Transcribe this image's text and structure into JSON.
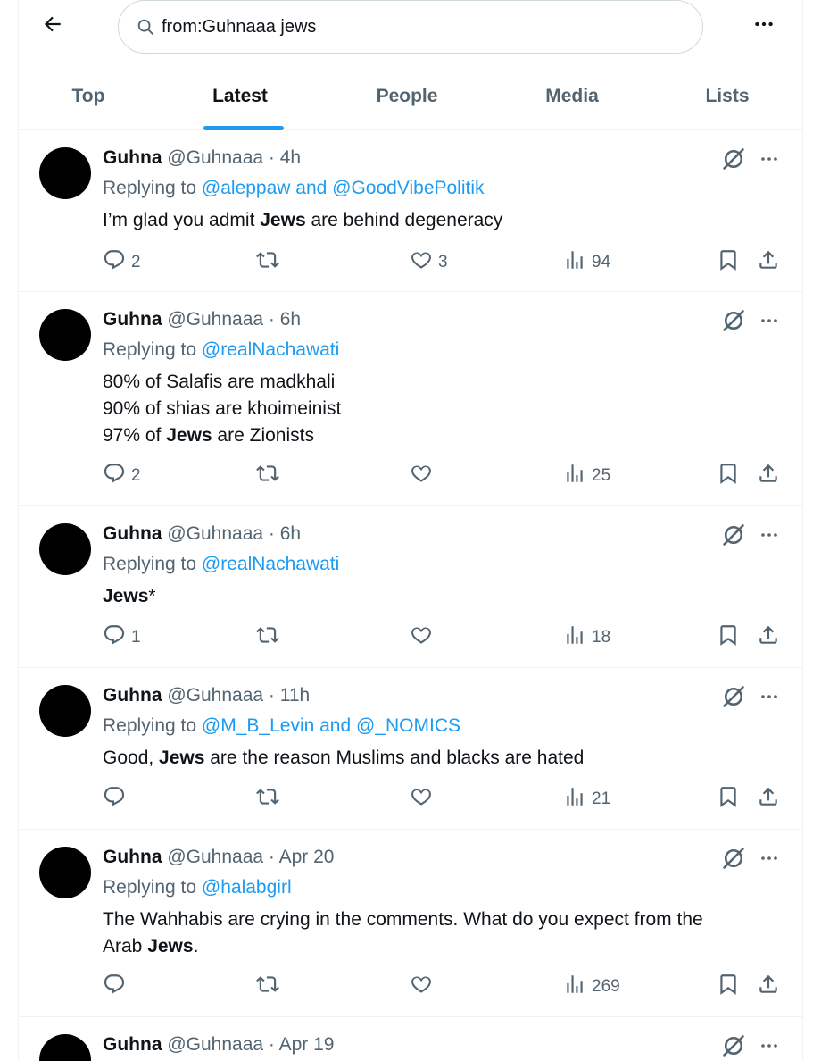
{
  "search": {
    "query": "from:Guhnaaa jews"
  },
  "tabs": [
    {
      "label": "Top"
    },
    {
      "label": "Latest"
    },
    {
      "label": "People"
    },
    {
      "label": "Media"
    },
    {
      "label": "Lists"
    }
  ],
  "active_tab": "Latest",
  "tweets": [
    {
      "name": "Guhna",
      "meta": "@Guhnaaa · 4h",
      "replying_prefix": "Replying to ",
      "replying_to": "@aleppaw and @GoodVibePolitik",
      "lines": [
        [
          "I’m glad you admit ",
          "Jews",
          " are behind degeneracy"
        ]
      ],
      "replies": "2",
      "retweets": "",
      "likes": "3",
      "views": "94"
    },
    {
      "name": "Guhna",
      "meta": "@Guhnaaa · 6h",
      "replying_prefix": "Replying to ",
      "replying_to": "@realNachawati",
      "lines": [
        [
          "80% of Salafis are madkhali",
          "",
          ""
        ],
        [
          "90% of shias are khoimeinist",
          "",
          ""
        ],
        [
          "97% of ",
          "Jews",
          " are Zionists"
        ]
      ],
      "replies": "2",
      "retweets": "",
      "likes": "",
      "views": "25"
    },
    {
      "name": "Guhna",
      "meta": "@Guhnaaa · 6h",
      "replying_prefix": "Replying to ",
      "replying_to": "@realNachawati",
      "lines": [
        [
          "",
          "Jews",
          "*"
        ]
      ],
      "replies": "1",
      "retweets": "",
      "likes": "",
      "views": "18"
    },
    {
      "name": "Guhna",
      "meta": "@Guhnaaa · 11h",
      "replying_prefix": "Replying to ",
      "replying_to": "@M_B_Levin and @_NOMICS",
      "lines": [
        [
          "Good, ",
          "Jews",
          " are the reason Muslims and blacks are hated"
        ]
      ],
      "replies": "",
      "retweets": "",
      "likes": "",
      "views": "21"
    },
    {
      "name": "Guhna",
      "meta": "@Guhnaaa · Apr 20",
      "replying_prefix": "Replying to ",
      "replying_to": "@halabgirl",
      "lines": [
        [
          "The Wahhabis are crying in the comments. What do you expect from the",
          "",
          ""
        ],
        [
          "Arab ",
          "Jews",
          "."
        ]
      ],
      "replies": "",
      "retweets": "",
      "likes": "",
      "views": "269"
    },
    {
      "name": "Guhna",
      "meta": "@Guhnaaa · Apr 19",
      "replying_prefix": "",
      "replying_to": "",
      "lines": [],
      "replies": "",
      "retweets": "",
      "likes": "",
      "views": ""
    }
  ],
  "icons": {
    "back": "arrow-left-icon",
    "search": "search-icon",
    "more": "more-horizontal-icon",
    "grok": "grok-icon",
    "reply": "reply-icon",
    "retweet": "retweet-icon",
    "like": "heart-icon",
    "views": "views-chart-icon",
    "bookmark": "bookmark-icon",
    "share": "share-icon"
  },
  "colors": {
    "accent": "#1d9bf0",
    "text": "#0f1419",
    "muted": "#536471",
    "border": "#eff3f4"
  }
}
